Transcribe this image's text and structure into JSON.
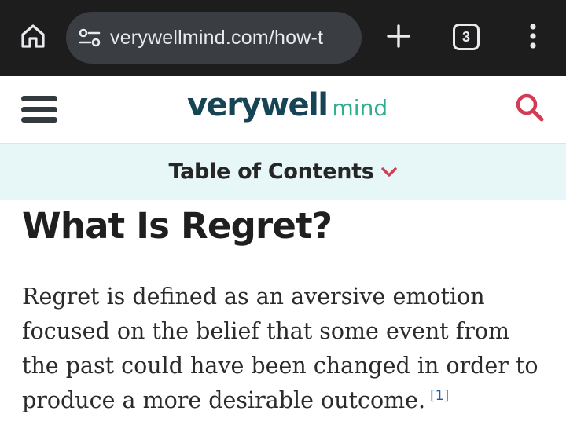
{
  "browser": {
    "url": "verywellmind.com/how-t",
    "tab_count": "3",
    "icons": {
      "home": "home-icon",
      "site_settings": "tune-icon",
      "new_tab": "plus-icon",
      "menu": "more-vert-icon"
    }
  },
  "site": {
    "logo_main": "verywell",
    "logo_sub": "mind",
    "colors": {
      "logo_main": "#164454",
      "logo_sub": "#2fad8f",
      "search_icon": "#d23c54",
      "toc_background": "#e7f6f7",
      "citation": "#1d5fa5"
    }
  },
  "toc": {
    "label": "Table of Contents"
  },
  "article": {
    "heading": "What Is Regret?",
    "body": "Regret is defined as an aversive emotion focused on the belief that some event from the past could have been changed in order to produce a more desirable outcome.",
    "citation": "[1]"
  }
}
